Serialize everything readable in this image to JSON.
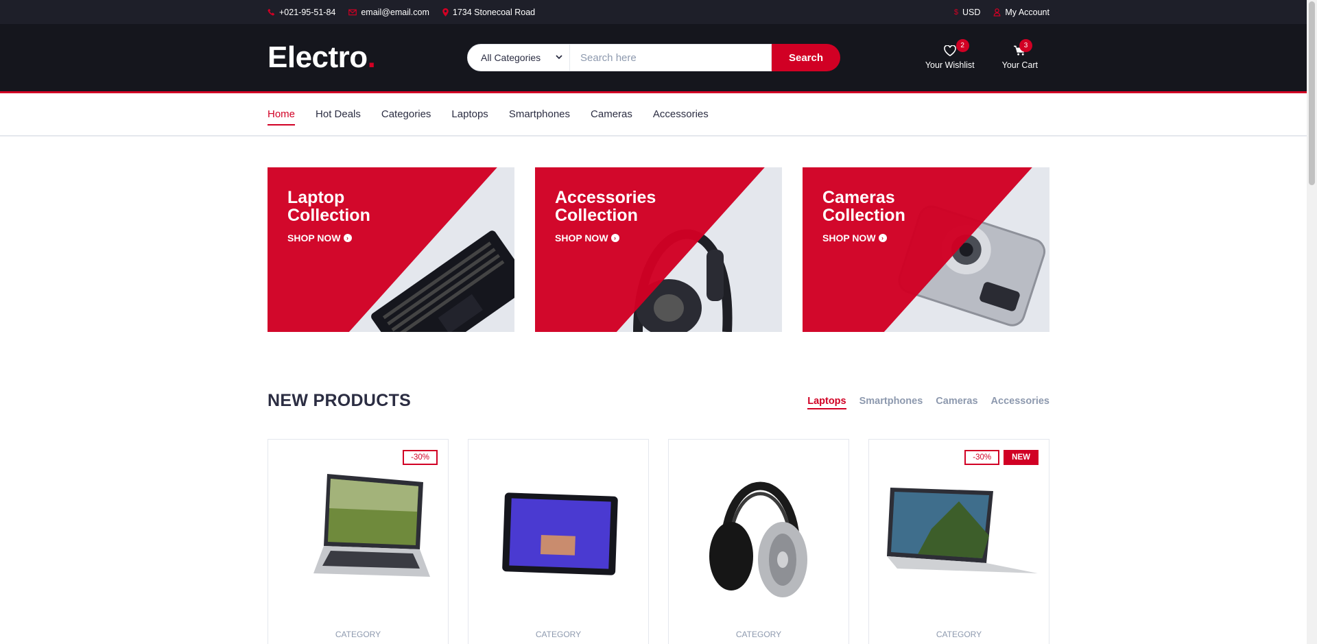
{
  "topbar": {
    "phone": "+021-95-51-84",
    "email": "email@email.com",
    "address": "1734 Stonecoal Road",
    "currency": "USD",
    "account": "My Account"
  },
  "header": {
    "logo_text": "Electro",
    "logo_dot": ".",
    "category_select": "All Categories",
    "search_placeholder": "Search here",
    "search_button": "Search",
    "wishlist_label": "Your Wishlist",
    "wishlist_qty": "2",
    "cart_label": "Your Cart",
    "cart_qty": "3"
  },
  "nav": {
    "items": [
      {
        "label": "Home",
        "active": true
      },
      {
        "label": "Hot Deals"
      },
      {
        "label": "Categories"
      },
      {
        "label": "Laptops"
      },
      {
        "label": "Smartphones"
      },
      {
        "label": "Cameras"
      },
      {
        "label": "Accessories"
      }
    ]
  },
  "collections": [
    {
      "title_line1": "Laptop",
      "title_line2": "Collection",
      "cta": "SHOP NOW",
      "icon": "laptop"
    },
    {
      "title_line1": "Accessories",
      "title_line2": "Collection",
      "cta": "SHOP NOW",
      "icon": "headphones"
    },
    {
      "title_line1": "Cameras",
      "title_line2": "Collection",
      "cta": "SHOP NOW",
      "icon": "camera"
    }
  ],
  "new_products": {
    "title": "New Products",
    "tabs": [
      {
        "label": "Laptops",
        "active": true
      },
      {
        "label": "Smartphones"
      },
      {
        "label": "Cameras"
      },
      {
        "label": "Accessories"
      }
    ],
    "items": [
      {
        "sale": "-30%",
        "new": "",
        "category": "CATEGORY",
        "icon": "laptop-landscape"
      },
      {
        "sale": "",
        "new": "",
        "category": "CATEGORY",
        "icon": "tablet"
      },
      {
        "sale": "",
        "new": "",
        "category": "CATEGORY",
        "icon": "headphones"
      },
      {
        "sale": "-30%",
        "new": "NEW",
        "category": "CATEGORY",
        "icon": "laptop-mountain"
      }
    ]
  },
  "colors": {
    "accent": "#D10024",
    "topbar_bg": "#1E1F29",
    "header_bg": "#15161D",
    "text": "#2B2D42",
    "muted": "#8D99AE",
    "border": "#E4E7ED"
  }
}
